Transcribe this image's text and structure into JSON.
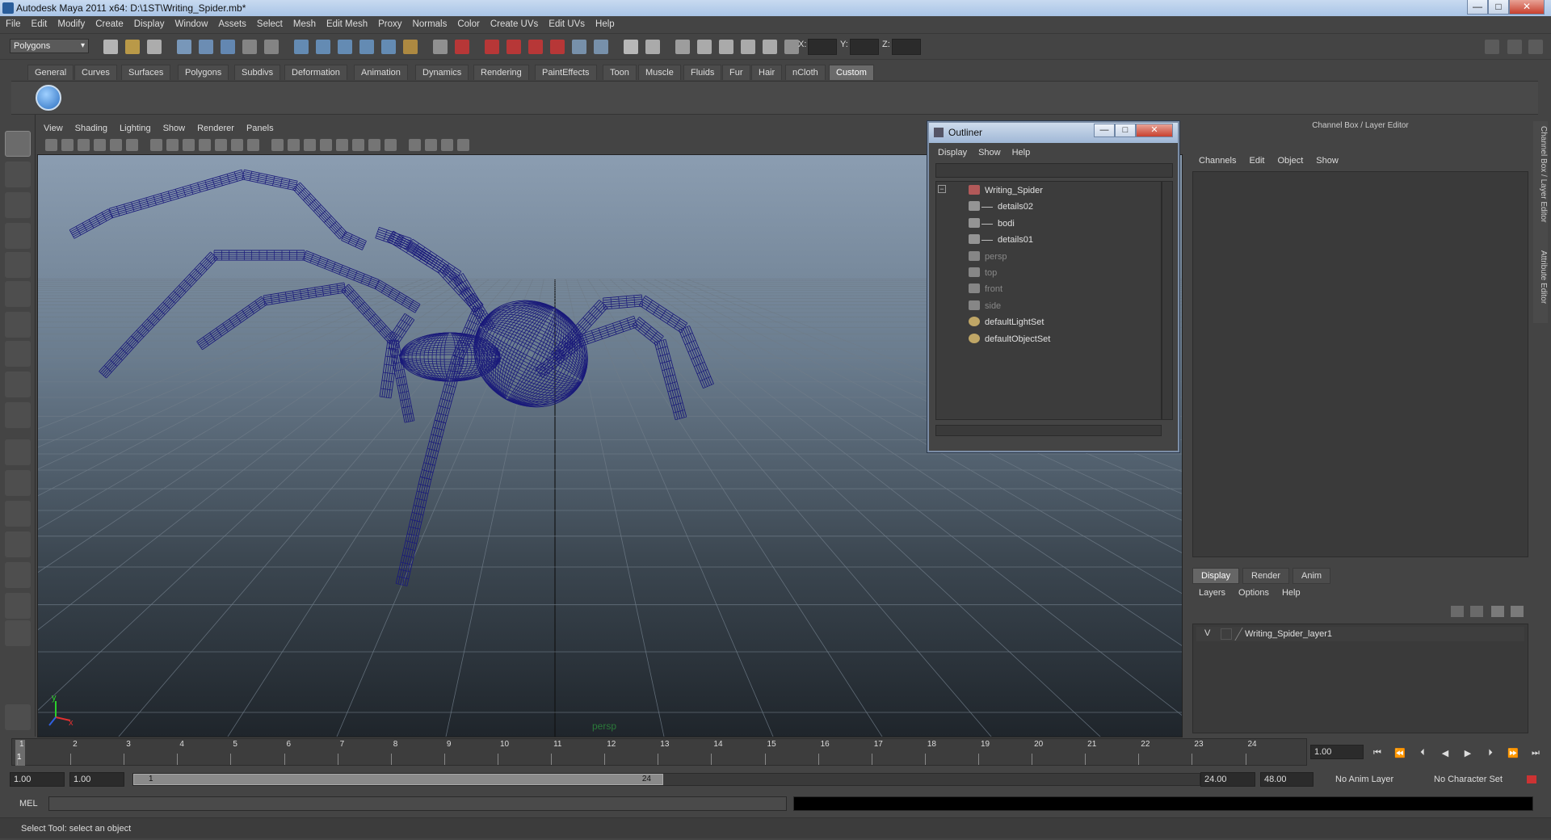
{
  "window": {
    "title": "Autodesk Maya 2011 x64: D:\\1ST\\Writing_Spider.mb*",
    "minimize": "—",
    "maximize": "□",
    "close": "✕"
  },
  "menubar": [
    "File",
    "Edit",
    "Modify",
    "Create",
    "Display",
    "Window",
    "Assets",
    "Select",
    "Mesh",
    "Edit Mesh",
    "Proxy",
    "Normals",
    "Color",
    "Create UVs",
    "Edit UVs",
    "Help"
  ],
  "statusline": {
    "mode": "Polygons",
    "x_label": "X:",
    "y_label": "Y:",
    "z_label": "Z:"
  },
  "shelf": {
    "tabs": [
      "General",
      "Curves",
      "Surfaces",
      "Polygons",
      "Subdivs",
      "Deformation",
      "Animation",
      "Dynamics",
      "Rendering",
      "PaintEffects",
      "Toon",
      "Muscle",
      "Fluids",
      "Fur",
      "Hair",
      "nCloth",
      "Custom"
    ],
    "active_tab": "Custom"
  },
  "viewport": {
    "menu": [
      "View",
      "Shading",
      "Lighting",
      "Show",
      "Renderer",
      "Panels"
    ],
    "camera_label": "persp",
    "axis_y": "y",
    "axis_x": "x",
    "wire_color": "#1a1a7a"
  },
  "outliner": {
    "title": "Outliner",
    "menu": [
      "Display",
      "Show",
      "Help"
    ],
    "collapse": "−",
    "items": [
      {
        "label": "Writing_Spider",
        "icon": "mesh-group-icon",
        "dim": false
      },
      {
        "label": "details02",
        "icon": "mesh-icon",
        "dim": false
      },
      {
        "label": "bodi",
        "icon": "mesh-icon",
        "dim": false
      },
      {
        "label": "details01",
        "icon": "mesh-icon",
        "dim": false
      },
      {
        "label": "persp",
        "icon": "camera-icon",
        "dim": true
      },
      {
        "label": "top",
        "icon": "camera-icon",
        "dim": true
      },
      {
        "label": "front",
        "icon": "camera-icon",
        "dim": true
      },
      {
        "label": "side",
        "icon": "camera-icon",
        "dim": true
      },
      {
        "label": "defaultLightSet",
        "icon": "set-icon",
        "dim": false
      },
      {
        "label": "defaultObjectSet",
        "icon": "set-icon",
        "dim": false
      }
    ]
  },
  "channelbox": {
    "title": "Channel Box / Layer Editor",
    "menu": [
      "Channels",
      "Edit",
      "Object",
      "Show"
    ],
    "side_tab": "Channel Box / Layer Editor",
    "attr_tab": "Attribute Editor"
  },
  "layer_editor": {
    "tabs": [
      "Display",
      "Render",
      "Anim"
    ],
    "active_tab": "Display",
    "menu": [
      "Layers",
      "Options",
      "Help"
    ],
    "layer_visible": "V",
    "layer_name": "Writing_Spider_layer1"
  },
  "timeline": {
    "start": 1,
    "end": 24,
    "current_frame": "1",
    "current_time": "1.00",
    "frame_numbers": [
      "1",
      "2",
      "3",
      "4",
      "5",
      "6",
      "7",
      "8",
      "9",
      "10",
      "11",
      "12",
      "13",
      "14",
      "15",
      "16",
      "17",
      "18",
      "19",
      "20",
      "21",
      "22",
      "23",
      "24"
    ]
  },
  "range": {
    "start_time": "1.00",
    "playback_start": "1.00",
    "handle_start": "1",
    "handle_end": "24",
    "playback_end": "24.00",
    "end_time": "48.00",
    "anim_layer": "No Anim Layer",
    "character_set": "No Character Set"
  },
  "cmdline": {
    "label": "MEL"
  },
  "helpline": {
    "text": "Select Tool: select an object"
  }
}
